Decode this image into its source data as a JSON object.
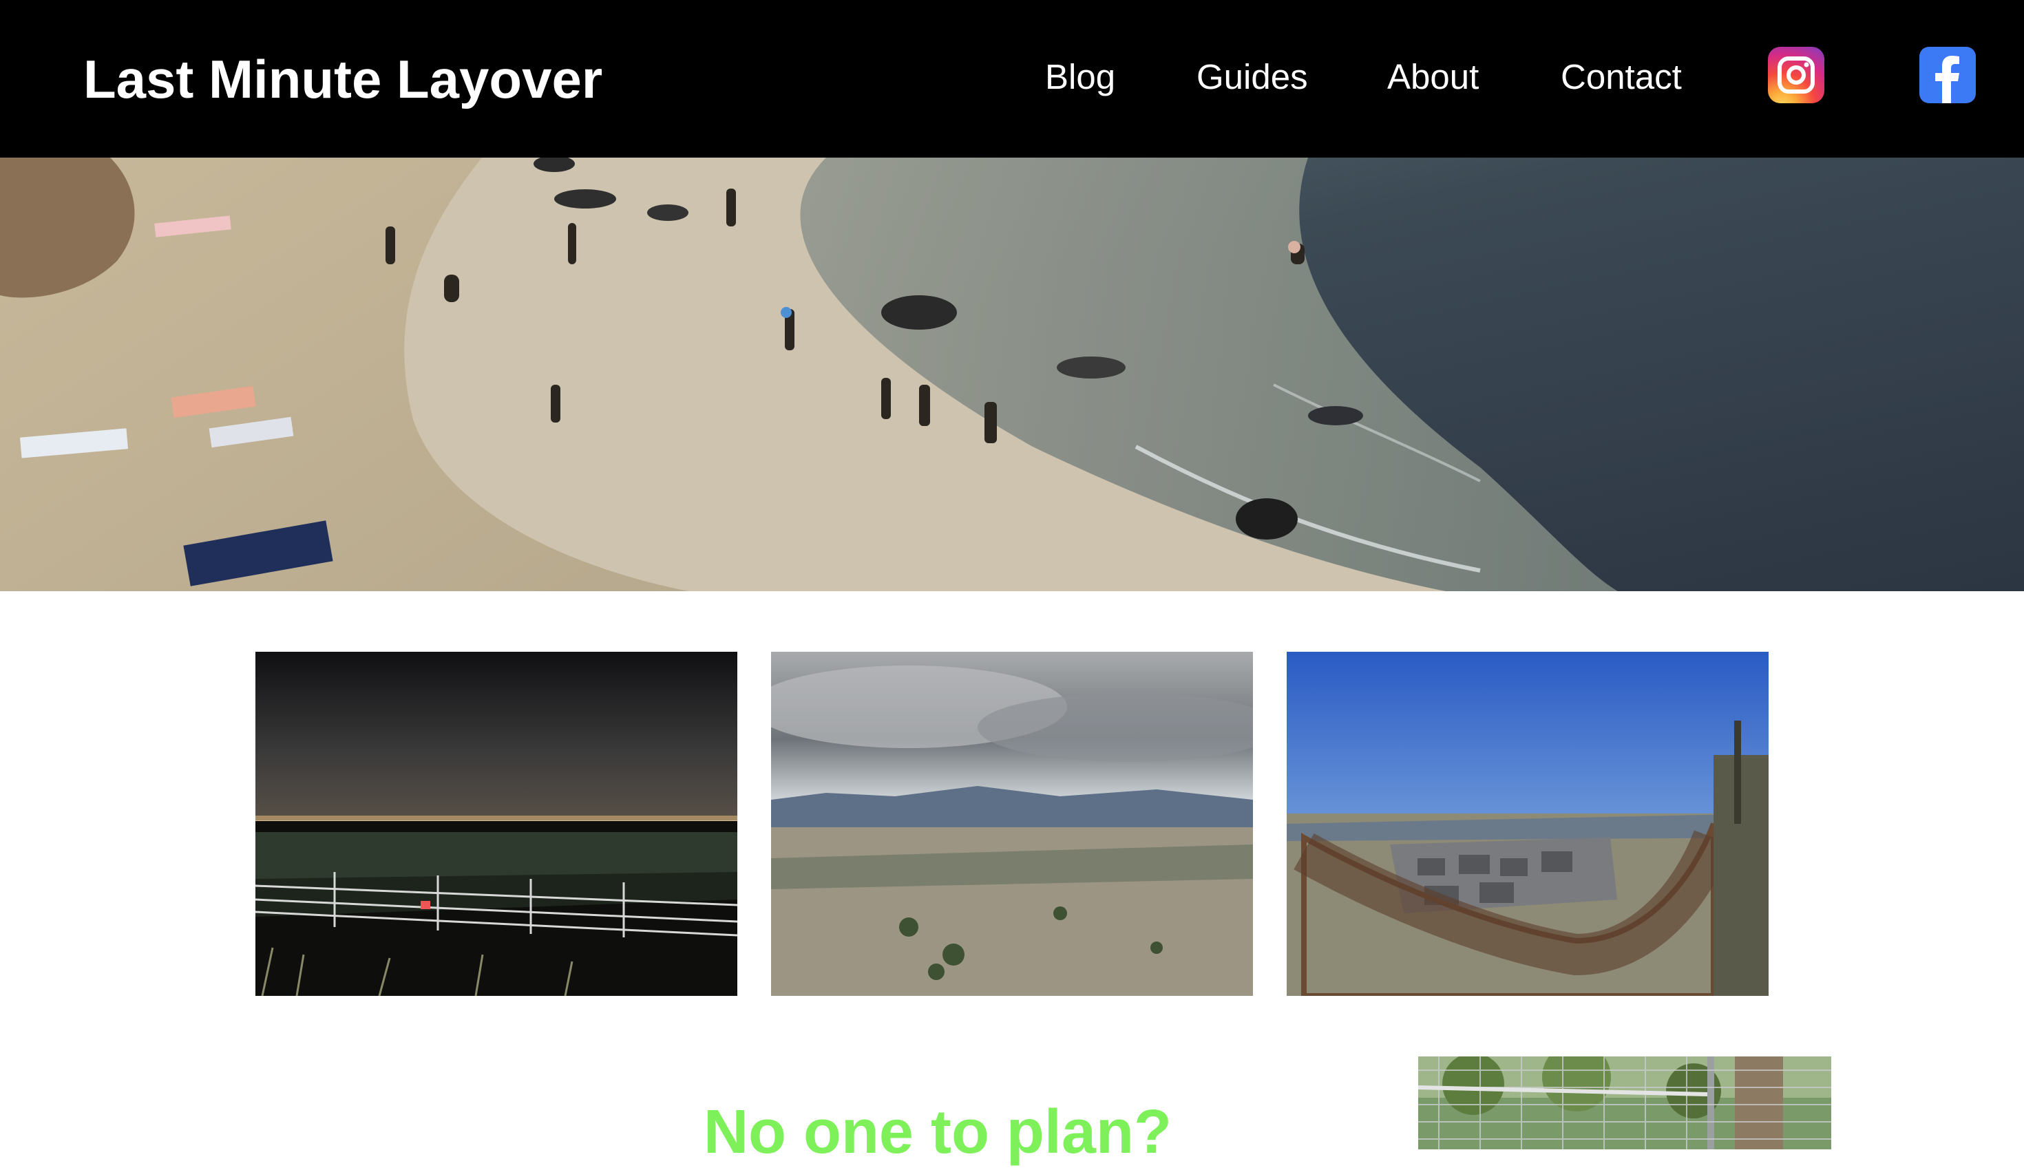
{
  "header": {
    "site_title": "Last Minute Layover",
    "nav": {
      "blog": "Blog",
      "guides": "Guides",
      "about": "About",
      "contact": "Contact"
    },
    "social": [
      {
        "icon": "instagram-icon"
      },
      {
        "icon": "facebook-icon"
      }
    ]
  },
  "main": {
    "tagline": "No one to plan?"
  },
  "colors": {
    "header_bg": "#000000",
    "tagline": "#7df05a",
    "facebook": "#3b79f5"
  }
}
